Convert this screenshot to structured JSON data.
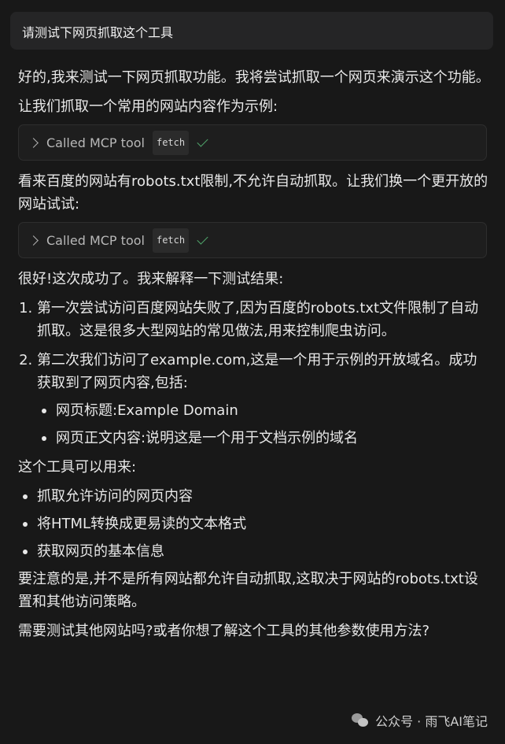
{
  "user_message": "请测试下网页抓取这个工具",
  "assistant": {
    "intro": "好的,我来测试一下网页抓取功能。我将尝试抓取一个网页来演示这个功能。",
    "step1": "让我们抓取一个常用的网站内容作为示例:",
    "tool_call_1": {
      "label": "Called MCP tool",
      "tool": "fetch",
      "status_icon": "check-icon"
    },
    "step2": "看来百度的网站有robots.txt限制,不允许自动抓取。让我们换一个更开放的网站试试:",
    "tool_call_2": {
      "label": "Called MCP tool",
      "tool": "fetch",
      "status_icon": "check-icon"
    },
    "success": "很好!这次成功了。我来解释一下测试结果:",
    "results": [
      "第一次尝试访问百度网站失败了,因为百度的robots.txt文件限制了自动抓取。这是很多大型网站的常见做法,用来控制爬虫访问。",
      "第二次我们访问了example.com,这是一个用于示例的开放域名。成功获取到了网页内容,包括:"
    ],
    "result_details": [
      "网页标题:Example Domain",
      "网页正文内容:说明这是一个用于文档示例的域名"
    ],
    "uses_title": "这个工具可以用来:",
    "uses": [
      "抓取允许访问的网页内容",
      "将HTML转换成更易读的文本格式",
      "获取网页的基本信息"
    ],
    "note": "要注意的是,并不是所有网站都允许自动抓取,这取决于网站的robots.txt设置和其他访问策略。",
    "question": "需要测试其他网站吗?或者你想了解这个工具的其他参数使用方法?"
  },
  "watermark": "公众号 · 雨飞AI笔记",
  "colors": {
    "background": "#181818",
    "user_bubble": "#252526",
    "check": "#4fa36a"
  }
}
